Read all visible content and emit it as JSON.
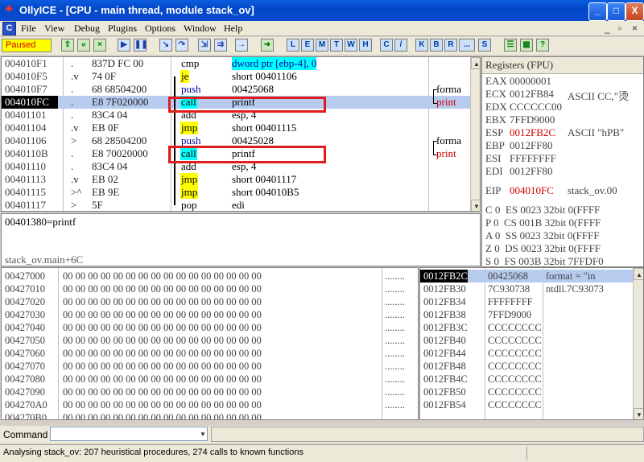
{
  "window": {
    "title": "OllyICE - [CPU - main thread, module stack_ov]",
    "min": "_",
    "max": "□",
    "close": "X"
  },
  "menu": [
    "File",
    "View",
    "Debug",
    "Plugins",
    "Options",
    "Window",
    "Help"
  ],
  "mdi_controls": {
    "min": "_",
    "restore": "▫",
    "close": "×"
  },
  "toolbar": {
    "status": "Paused",
    "letters": [
      "L",
      "E",
      "M",
      "T",
      "W",
      "H",
      "C",
      "/",
      "K",
      "B",
      "R",
      "...",
      "S"
    ]
  },
  "disasm": {
    "rows": [
      {
        "addr": "004010F1",
        "mark": ".",
        "hex": "837D FC 00",
        "mn": "cmp",
        "op": "dword ptr [ebp-4], 0",
        "cm": ""
      },
      {
        "addr": "004010F5",
        "mark": ".v",
        "hex": "74 0F",
        "mn": "je",
        "op": "short 00401106",
        "cm": ""
      },
      {
        "addr": "004010F7",
        "mark": ".",
        "hex": "68 68504200",
        "mn": "push",
        "op": "00425068",
        "cm": "forma"
      },
      {
        "addr": "004010FC",
        "mark": ".",
        "hex": "E8 7F020000",
        "mn": "call",
        "op": "printf",
        "cm": "print"
      },
      {
        "addr": "00401101",
        "mark": ".",
        "hex": "83C4 04",
        "mn": "add",
        "op": "esp, 4",
        "cm": ""
      },
      {
        "addr": "00401104",
        "mark": ".v",
        "hex": "EB 0F",
        "mn": "jmp",
        "op": "short 00401115",
        "cm": ""
      },
      {
        "addr": "00401106",
        "mark": ">",
        "hex": "68 28504200",
        "mn": "push",
        "op": "00425028",
        "cm": "forma"
      },
      {
        "addr": "0040110B",
        "mark": ".",
        "hex": "E8 70020000",
        "mn": "call",
        "op": "printf",
        "cm": "print"
      },
      {
        "addr": "00401110",
        "mark": ".",
        "hex": "83C4 04",
        "mn": "add",
        "op": "esp, 4",
        "cm": ""
      },
      {
        "addr": "00401113",
        "mark": ".v",
        "hex": "EB 02",
        "mn": "jmp",
        "op": "short 00401117",
        "cm": ""
      },
      {
        "addr": "00401115",
        "mark": ">^",
        "hex": "EB 9E",
        "mn": "jmp",
        "op": "short 004010B5",
        "cm": ""
      },
      {
        "addr": "00401117",
        "mark": ">",
        "hex": "5F",
        "mn": "pop",
        "op": "edi",
        "cm": ""
      }
    ]
  },
  "info": {
    "line1": "00401380=printf",
    "line2": "stack_ov.main+6C"
  },
  "registers": {
    "header": "Registers (FPU)",
    "gp": [
      {
        "name": "EAX",
        "val": "00000001",
        "extra": ""
      },
      {
        "name": "ECX",
        "val": "0012FB84",
        "extra": "ASCII CC,\"烫"
      },
      {
        "name": "EDX",
        "val": "CCCCCC00",
        "extra": ""
      },
      {
        "name": "EBX",
        "val": "7FFD9000",
        "extra": ""
      },
      {
        "name": "ESP",
        "val": "0012FB2C",
        "extra": "ASCII \"hPB\""
      },
      {
        "name": "EBP",
        "val": "0012FF80",
        "extra": ""
      },
      {
        "name": "ESI",
        "val": "FFFFFFFF",
        "extra": ""
      },
      {
        "name": "EDI",
        "val": "0012FF80",
        "extra": ""
      }
    ],
    "eip": {
      "name": "EIP",
      "val": "004010FC",
      "extra": "stack_ov.00"
    },
    "flags": [
      "C 0  ES 0023 32bit 0(FFFF",
      "P 0  CS 001B 32bit 0(FFFF",
      "A 0  SS 0023 32bit 0(FFFF",
      "Z 0  DS 0023 32bit 0(FFFF",
      "S 0  FS 003B 32bit 7FFDF0"
    ]
  },
  "dump": {
    "rows": [
      "00427000",
      "00427010",
      "00427020",
      "00427030",
      "00427040",
      "00427050",
      "00427060",
      "00427070",
      "00427080",
      "00427090",
      "004270A0",
      "004270B0"
    ],
    "bytes": "00 00 00 00 00 00 00 00 00 00 00 00 00 00 00 00",
    "ascii": "........"
  },
  "stack": {
    "rows": [
      {
        "addr": "0012FB2C",
        "val": "00425068",
        "cm": "format = \"in"
      },
      {
        "addr": "0012FB30",
        "val": "7C930738",
        "cm": "ntdll.7C93073"
      },
      {
        "addr": "0012FB34",
        "val": "FFFFFFFF",
        "cm": ""
      },
      {
        "addr": "0012FB38",
        "val": "7FFD9000",
        "cm": ""
      },
      {
        "addr": "0012FB3C",
        "val": "CCCCCCCC",
        "cm": ""
      },
      {
        "addr": "0012FB40",
        "val": "CCCCCCCC",
        "cm": ""
      },
      {
        "addr": "0012FB44",
        "val": "CCCCCCCC",
        "cm": ""
      },
      {
        "addr": "0012FB48",
        "val": "CCCCCCCC",
        "cm": ""
      },
      {
        "addr": "0012FB4C",
        "val": "CCCCCCCC",
        "cm": ""
      },
      {
        "addr": "0012FB50",
        "val": "CCCCCCCC",
        "cm": ""
      },
      {
        "addr": "0012FB54",
        "val": "CCCCCCCC",
        "cm": ""
      }
    ]
  },
  "command": {
    "label": "Command",
    "value": ""
  },
  "status": {
    "text": "Analysing stack_ov: 207 heuristical procedures, 274 calls to known functions"
  }
}
